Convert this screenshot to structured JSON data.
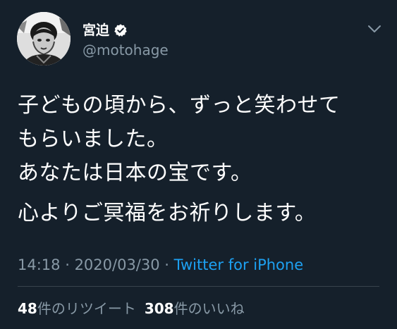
{
  "author": {
    "display_name": "宮迫",
    "handle": "@motohage",
    "verified": true
  },
  "tweet": {
    "lines": [
      "子どもの頃から、ずっと笑わせて",
      "もらいました。",
      "あなたは日本の宝です。",
      "心よりご冥福をお祈りします。"
    ],
    "time": "14:18",
    "separator": " · ",
    "date": "2020/03/30",
    "source": "Twitter for iPhone"
  },
  "stats": {
    "retweets_count": "48",
    "retweets_label": "件のリツイート",
    "likes_count": "308",
    "likes_label": "件のいいね"
  },
  "colors": {
    "background": "#15202b",
    "text": "#ffffff",
    "secondary": "#8899a6",
    "link": "#1da1f2",
    "divider": "#38444d"
  }
}
